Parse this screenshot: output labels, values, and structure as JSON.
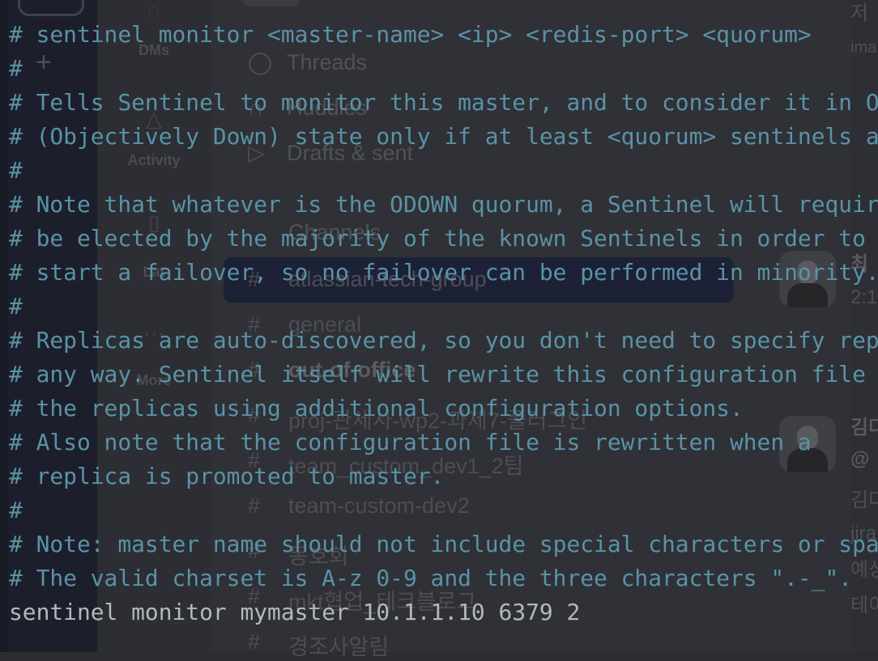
{
  "background_app": {
    "nav": {
      "dms_label": "DMs",
      "activity_label": "Activity",
      "later_label": "Lat",
      "more_label": "More"
    },
    "menu": {
      "threads": "Threads",
      "huddles": "Huddles",
      "drafts": "Drafts & sent",
      "channels_header": "Channels"
    },
    "channels": [
      {
        "name": "atlassian-tech-group",
        "selected": true
      },
      {
        "name": "general",
        "bold": false
      },
      {
        "name": "out-of-office",
        "bold": true
      },
      {
        "name": "proj-관세사-wp2-과제7-플러그인",
        "bold": false
      },
      {
        "name": "team_custom_dev1_2팀",
        "bold": false
      },
      {
        "name": "team-custom-dev2",
        "bold": false
      },
      {
        "name": "동호회",
        "bold": false
      },
      {
        "name": "mkt협업_테크블로그",
        "bold": false
      },
      {
        "name": "경조사알림",
        "bold": false
      }
    ],
    "right_panel": {
      "top_text": "저",
      "ima": "ima",
      "msg1_name": "최",
      "msg1_time": "2:1",
      "msg2_name": "김다",
      "msg2_mention": "@",
      "msg2_line1": "김다",
      "msg2_line2": "jira",
      "msg2_line3": "예상",
      "msg2_line4": "테이"
    }
  },
  "terminal": {
    "lines": [
      "# sentinel monitor <master-name> <ip> <redis-port> <quorum>",
      "#",
      "# Tells Sentinel to monitor this master, and to consider it in O_DOWN",
      "# (Objectively Down) state only if at least <quorum> sentinels agree.",
      "#",
      "# Note that whatever is the ODOWN quorum, a Sentinel will require to",
      "# be elected by the majority of the known Sentinels in order to",
      "# start a failover, so no failover can be performed in minority.",
      "#",
      "# Replicas are auto-discovered, so you don't need to specify replicas in",
      "# any way. Sentinel itself will rewrite this configuration file adding",
      "# the replicas using additional configuration options.",
      "# Also note that the configuration file is rewritten when a",
      "# replica is promoted to master.",
      "#",
      "# Note: master name should not include special characters or spaces.",
      "# The valid charset is A-z 0-9 and the three characters \".-_\".",
      "sentinel monitor mymaster 10.1.1.10 6379 2"
    ]
  },
  "colors": {
    "comment": "#5a92a7",
    "command": "#b4b8bd",
    "background": "#2b2d31"
  }
}
